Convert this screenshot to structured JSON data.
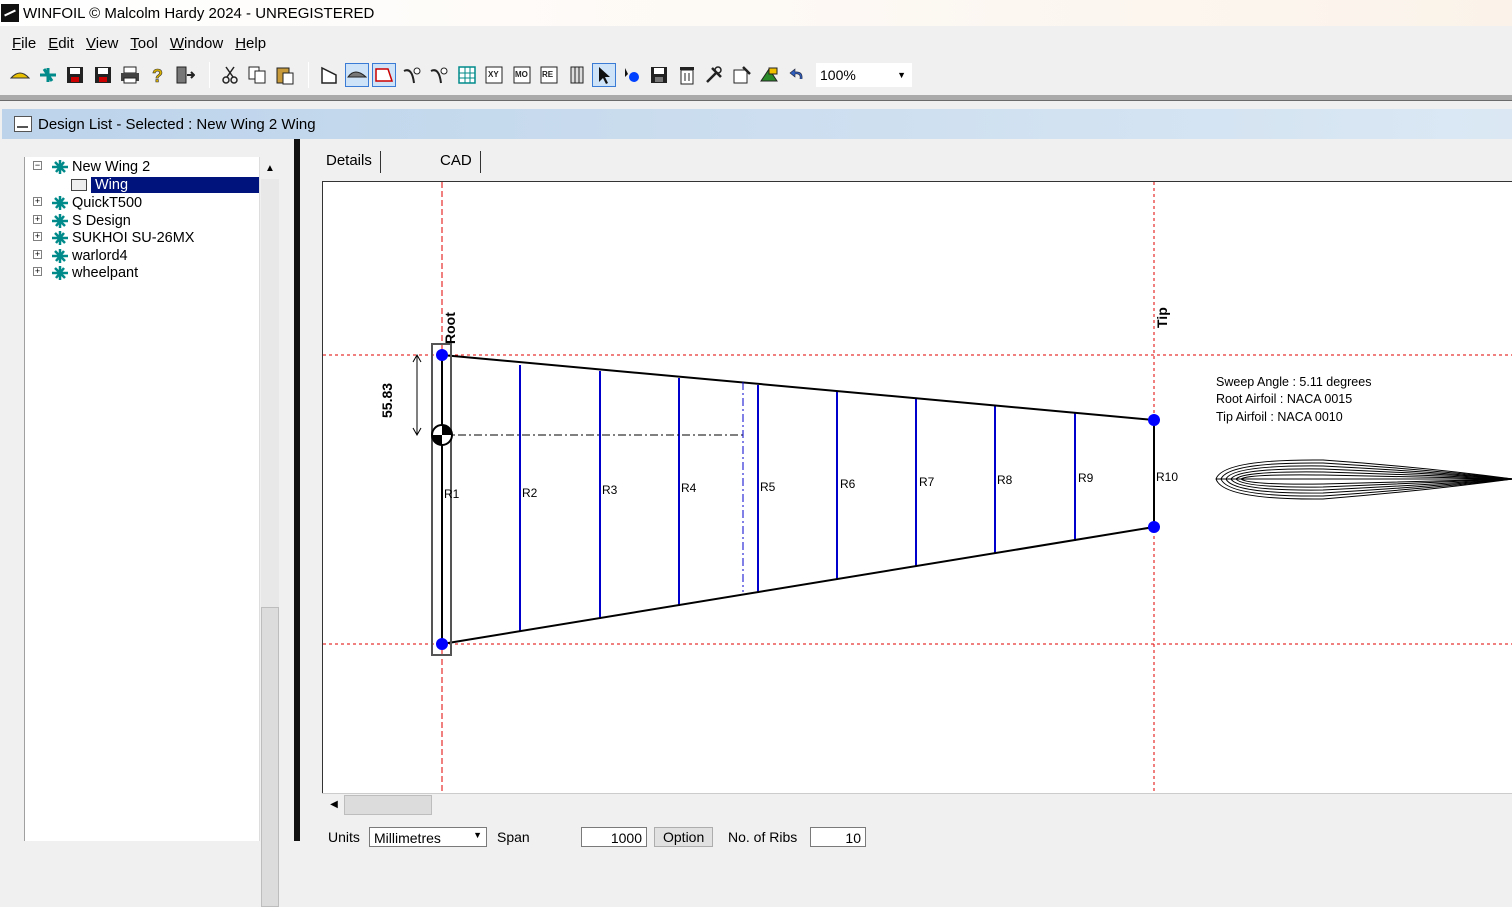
{
  "window": {
    "title": "WINFOIL © Malcolm Hardy 2024 - UNREGISTERED"
  },
  "menu": [
    {
      "acc": "F",
      "rest": "ile"
    },
    {
      "acc": "E",
      "rest": "dit"
    },
    {
      "acc": "V",
      "rest": "iew"
    },
    {
      "acc": "T",
      "rest": "ool"
    },
    {
      "acc": "W",
      "rest": "indow"
    },
    {
      "acc": "H",
      "rest": "elp"
    }
  ],
  "toolbar": {
    "zoom_value": "100%",
    "zoom_dropdown_icon": "chevron-down-icon"
  },
  "child_window": {
    "title": "Design List - Selected : New Wing 2 Wing"
  },
  "tree": {
    "items": [
      {
        "label": "New Wing 2",
        "expanded": true
      },
      {
        "label": "Wing",
        "selected": true
      },
      {
        "label": "QuickT500"
      },
      {
        "label": "S Design"
      },
      {
        "label": "SUKHOI SU-26MX"
      },
      {
        "label": "warlord4"
      },
      {
        "label": "wheelpant"
      }
    ]
  },
  "tabs": {
    "details": "Details",
    "cad": "CAD"
  },
  "drawing": {
    "root_label": "Root",
    "tip_label": "Tip",
    "dimension": "55.83",
    "ribs": [
      "R1",
      "R2",
      "R3",
      "R4",
      "R5",
      "R6",
      "R7",
      "R8",
      "R9",
      "R10"
    ],
    "info": {
      "sweep": "Sweep Angle : 5.11 degrees",
      "root_airfoil": "Root Airfoil : NACA 0015",
      "tip_airfoil": "Tip Airfoil    : NACA 0010"
    },
    "colors": {
      "outline": "#000000",
      "rib": "#0000cc",
      "guide": "#e00000",
      "node": "#0000ff"
    }
  },
  "bottom": {
    "units_label": "Units",
    "units_value": "Millimetres",
    "span_label": "Span",
    "span_value": "1000",
    "option_button": "Option",
    "ribs_label": "No. of Ribs",
    "ribs_value": "10"
  }
}
